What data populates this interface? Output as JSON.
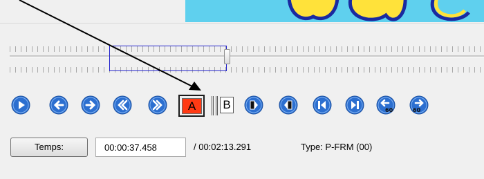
{
  "colors": {
    "video_bg": "#5fd0ee",
    "nav_button": "#2c6fd0",
    "marker_a_fill": "#ff3a14",
    "selection_border": "#2222cc"
  },
  "nav_buttons": {
    "play": {
      "icon": "play-icon"
    },
    "prev": {
      "icon": "arrow-left-icon"
    },
    "next": {
      "icon": "arrow-right-icon"
    },
    "rewind": {
      "icon": "rewind-icon"
    },
    "fast_forward": {
      "icon": "fast-forward-icon"
    },
    "goto_a": {
      "icon": "goto-marker-a-icon"
    },
    "goto_b": {
      "icon": "goto-marker-b-icon"
    },
    "first": {
      "icon": "skip-first-icon"
    },
    "last": {
      "icon": "skip-last-icon"
    },
    "back_60": {
      "icon": "back-60-icon",
      "label": "60"
    },
    "forward_60": {
      "icon": "forward-60-icon",
      "label": "60"
    }
  },
  "markers": {
    "a_label": "A",
    "b_label": "B"
  },
  "time": {
    "button_label": "Temps:",
    "current": "00:00:37.458",
    "duration": "/ 00:02:13.291",
    "frame_type": "Type: P-FRM (00)"
  }
}
